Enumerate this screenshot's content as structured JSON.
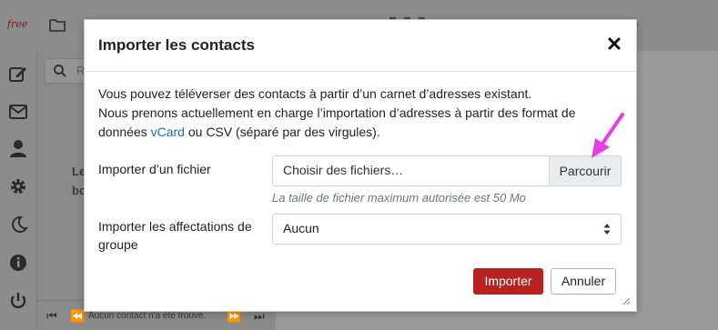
{
  "app": {
    "brand": "free",
    "search_placeholder": "Re",
    "empty_message": "Le\nbo",
    "pager_text": "Aucun contact n'a été trouvé."
  },
  "modal": {
    "title": "Importer les contacts",
    "intro_line1": "Vous pouvez téléverser des contacts à partir d’un carnet d’adresses existant.",
    "intro_line2": "Nous prenons actuellement en charge l’importation d’adresses à partir des format de",
    "intro_line3_pre": "données ",
    "intro_link": "vCard",
    "intro_line3_post": " ou CSV (séparé par des virgules).",
    "file_label": "Importer d’un fichier",
    "file_placeholder": "Choisir des fichiers…",
    "browse_label": "Parcourir",
    "file_hint": "La taille de fichier maximum autorisée est 50 Mo",
    "group_label_line1": "Importer les affectations de",
    "group_label_line2": "groupe",
    "group_selected": "Aucun",
    "import_button": "Importer",
    "cancel_button": "Annuler"
  },
  "colors": {
    "primary": "#b7231f",
    "link": "#1f6fb2",
    "annotation_arrow": "#e83ee8"
  }
}
